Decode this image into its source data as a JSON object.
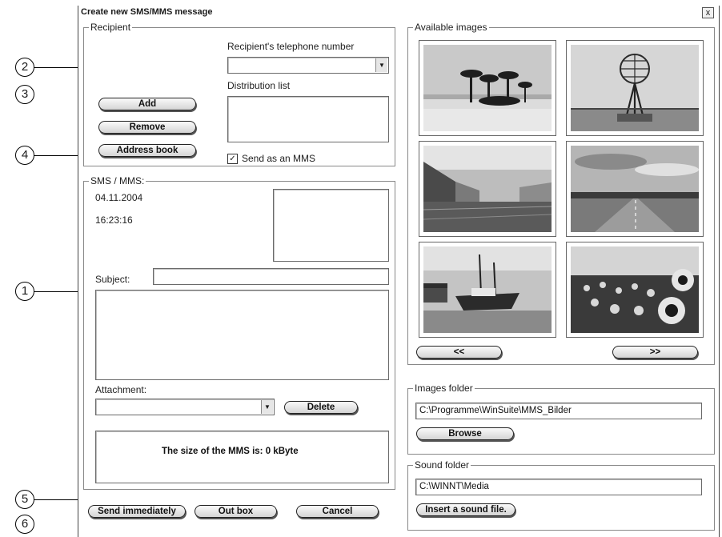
{
  "callouts": [
    "2",
    "3",
    "4",
    "1",
    "5",
    "6"
  ],
  "window": {
    "title": "Create new SMS/MMS message",
    "close_label": "x"
  },
  "recipient": {
    "legend": "Recipient",
    "phone_label": "Recipient's telephone number",
    "phone_value": "",
    "distribution_label": "Distribution list",
    "add_label": "Add",
    "remove_label": "Remove",
    "address_book_label": "Address book",
    "send_mms_checked": true,
    "send_mms_label": "Send as an MMS"
  },
  "sms": {
    "legend": "SMS / MMS:",
    "date": "04.11.2004",
    "time": "16:23:16",
    "subject_label": "Subject:",
    "subject_value": "",
    "attachment_label": "Attachment:",
    "attachment_value": "",
    "delete_label": "Delete",
    "size_text": "The size of the MMS is: 0 kByte"
  },
  "footer": {
    "send_label": "Send immediately",
    "outbox_label": "Out box",
    "cancel_label": "Cancel"
  },
  "images": {
    "legend": "Available images",
    "items": [
      "palm-beach-image",
      "globe-monument-image",
      "harbour-houses-image",
      "road-sky-image",
      "fishing-boat-image",
      "sunflowers-image"
    ],
    "prev_label": "<<",
    "next_label": ">>"
  },
  "images_folder": {
    "legend": "Images folder",
    "path": "C:\\Programme\\WinSuite\\MMS_Bilder",
    "browse_label": "Browse"
  },
  "sound_folder": {
    "legend": "Sound folder",
    "path": "C:\\WINNT\\Media",
    "insert_label": "Insert a sound file."
  }
}
